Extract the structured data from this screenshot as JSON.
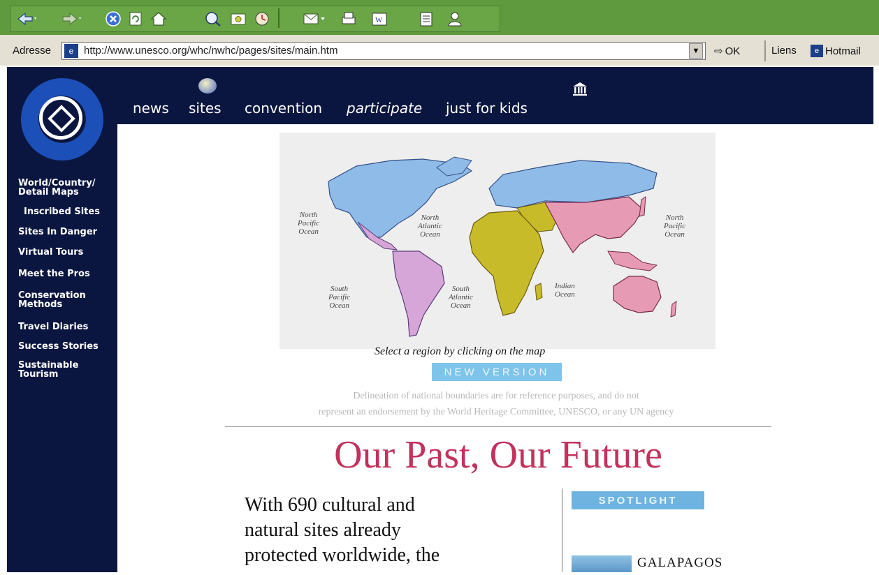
{
  "browser": {
    "toolbar_icons": [
      "back-icon",
      "forward-icon",
      "stop-icon",
      "refresh-icon",
      "home-icon",
      "search-icon",
      "favorites-icon",
      "history-icon",
      "mail-icon",
      "print-icon",
      "edit-icon",
      "discuss-icon",
      "messenger-icon"
    ],
    "address_label": "Adresse",
    "url": "http://www.unesco.org/whc/nwhc/pages/sites/main.htm",
    "go_label": "OK",
    "links_label": "Liens",
    "hotmail_label": "Hotmail"
  },
  "site": {
    "top_nav": [
      "news",
      "sites",
      "convention",
      "participate",
      "just for kids"
    ],
    "side_nav": [
      [
        "World/Country/",
        "Detail Maps"
      ],
      [
        "Inscribed Sites"
      ],
      [
        "Sites In Danger"
      ],
      [
        "Virtual Tours"
      ],
      [
        "Meet the Pros"
      ],
      [
        "Conservation",
        "Methods"
      ],
      [
        "Travel Diaries"
      ],
      [
        "Success Stories"
      ],
      [
        "Sustainable",
        "Tourism"
      ]
    ],
    "ocean_labels": [
      [
        "North",
        "Pacific",
        "Ocean"
      ],
      [
        "North",
        "Atlantic",
        "Ocean"
      ],
      [
        "North",
        "Pacific",
        "Ocean"
      ],
      [
        "South",
        "Pacific",
        "Ocean"
      ],
      [
        "South",
        "Atlantic",
        "Ocean"
      ],
      [
        "Indian",
        "Ocean"
      ]
    ],
    "map_caption": "Select a region by clicking on the map",
    "new_version_label": "NEW VERSION",
    "disclaimer_line1": "Delineation of national boundaries are for reference purposes, and do not",
    "disclaimer_line2": "represent an endorsement by the World Heritage Committee, UNESCO, or any UN agency",
    "headline": "Our Past, Our Future",
    "intro_lines": [
      "With 690 cultural and",
      "natural sites already",
      "protected worldwide, the"
    ],
    "spotlight_label": "SPOTLIGHT",
    "spotlight_item": "GALAPAGOS",
    "colors": {
      "chrome_green": "#5f9a3e",
      "nav_navy": "#0b1640",
      "headline_red": "#c2325c",
      "button_blue": "#7ec4ea",
      "region_blue": "#8fbbe8",
      "region_pink": "#e69ab4",
      "region_yellow": "#c8bb2a",
      "region_violet": "#d7a6d8"
    }
  }
}
